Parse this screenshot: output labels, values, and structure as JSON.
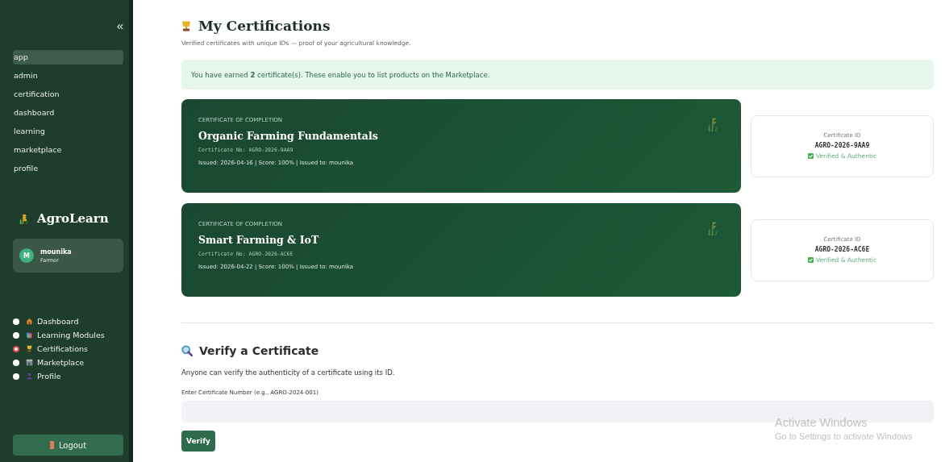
{
  "sidebar": {
    "collapse": "«",
    "pages": [
      {
        "label": "app",
        "selected": true
      },
      {
        "label": "admin",
        "selected": false
      },
      {
        "label": "certification",
        "selected": false
      },
      {
        "label": "dashboard",
        "selected": false
      },
      {
        "label": "learning",
        "selected": false
      },
      {
        "label": "marketplace",
        "selected": false
      },
      {
        "label": "profile",
        "selected": false
      }
    ],
    "brand": "AgroLearn",
    "user": {
      "initial": "M",
      "name": "mounika",
      "role": "Farmer"
    },
    "nav": [
      {
        "label": "Dashboard",
        "kind": "house",
        "selected": false
      },
      {
        "label": "Learning Modules",
        "kind": "books",
        "selected": false
      },
      {
        "label": "Certifications",
        "kind": "trophy",
        "selected": true
      },
      {
        "label": "Marketplace",
        "kind": "market",
        "selected": false
      },
      {
        "label": "Profile",
        "kind": "person",
        "selected": false
      }
    ],
    "logout": "Logout"
  },
  "header": {
    "title": "My Certifications",
    "subtitle": "Verified certificates with unique IDs — proof of your agricultural knowledge."
  },
  "alert": "You have earned **2** certificate(s). These enable you to list products on the Marketplace.",
  "certificates": [
    {
      "eyebrow": "CERTIFICATE OF COMPLETION",
      "course": "Organic Farming Fundamentals",
      "number": "Certificate No: AGRO-2026-9AA9",
      "meta": "Issued: 2026-04-16 | Score: 100% | Issued to: mounika",
      "id_label": "Certificate ID",
      "id": "AGRO-2026-9AA9",
      "verified": "Verified & Authentic"
    },
    {
      "eyebrow": "CERTIFICATE OF COMPLETION",
      "course": "Smart Farming & IoT",
      "number": "Certificate No: AGRO-2026-AC6E",
      "meta": "Issued: 2026-04-22 | Score: 100% | Issued to: mounika",
      "id_label": "Certificate ID",
      "id": "AGRO-2026-AC6E",
      "verified": "Verified & Authentic"
    }
  ],
  "verify": {
    "title": "Verify a Certificate",
    "description": "Anyone can verify the authenticity of a certificate using its ID.",
    "field_label": "Enter Certificate Number (e.g., AGRO-2024-001)",
    "button": "Verify"
  },
  "os_notice": {
    "title": "Activate Windows",
    "subtitle": "Go to Settings to activate Windows"
  }
}
